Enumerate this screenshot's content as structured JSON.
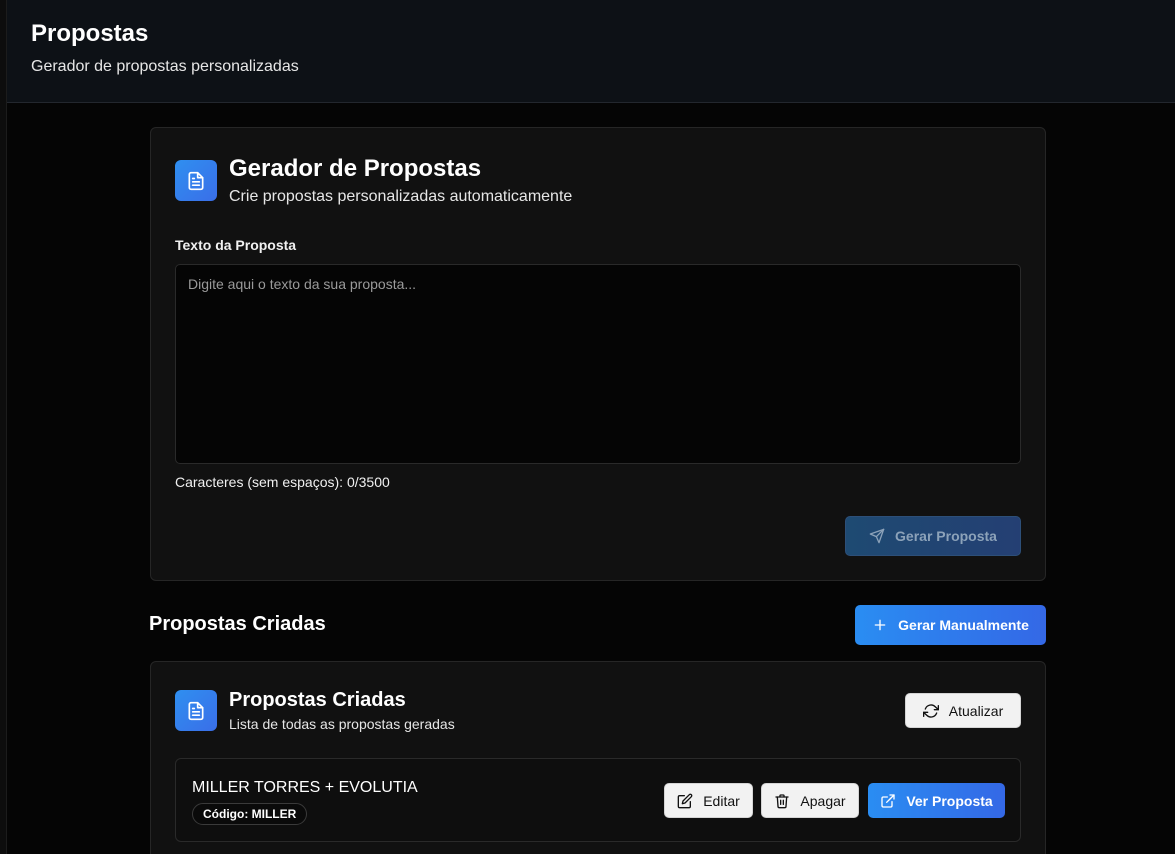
{
  "header": {
    "title": "Propostas",
    "subtitle": "Gerador de propostas personalizadas"
  },
  "generator": {
    "icon": "document-icon",
    "title": "Gerador de Propostas",
    "subtitle": "Crie propostas personalizadas automaticamente",
    "field_label": "Texto da Proposta",
    "textarea_value": "",
    "textarea_placeholder": "Digite aqui o texto da sua proposta...",
    "char_count": "Caracteres (sem espaços): 0/3500",
    "generate_button": "Gerar Proposta",
    "generate_icon": "send-icon"
  },
  "created_section": {
    "title": "Propostas Criadas",
    "manual_button": "Gerar Manualmente",
    "manual_icon": "plus-icon"
  },
  "list_card": {
    "icon": "document-icon",
    "title": "Propostas Criadas",
    "subtitle": "Lista de todas as propostas geradas",
    "refresh_button": "Atualizar",
    "refresh_icon": "refresh-icon",
    "items": [
      {
        "name": "MILLER TORRES + EVOLUTIA",
        "code": "Código: MILLER",
        "edit_label": "Editar",
        "delete_label": "Apagar",
        "view_label": "Ver Proposta"
      }
    ]
  },
  "colors": {
    "accent": "#2f8ff0",
    "background": "#050505",
    "card": "#111111"
  }
}
